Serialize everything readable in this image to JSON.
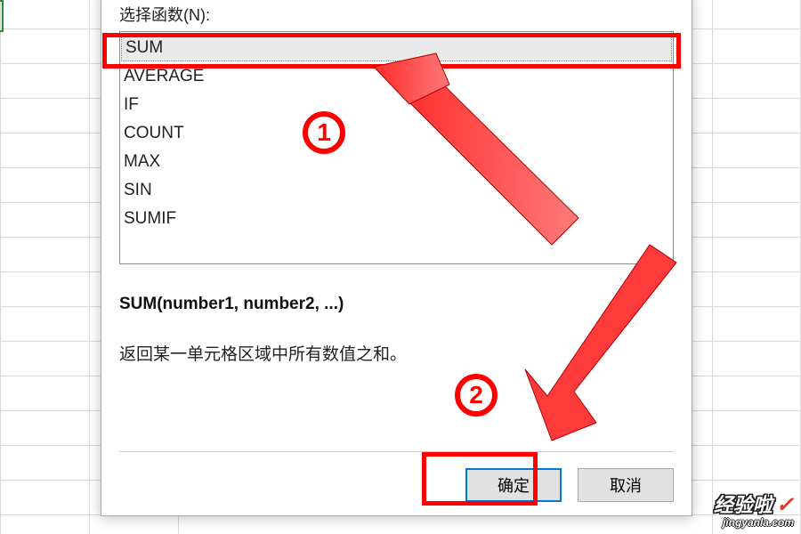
{
  "dialog": {
    "select_label": "选择函数(N):",
    "functions": [
      "SUM",
      "AVERAGE",
      "IF",
      "COUNT",
      "MAX",
      "SIN",
      "SUMIF"
    ],
    "syntax": "SUM(number1, number2, ...)",
    "description": "返回某一单元格区域中所有数值之和。",
    "ok_label": "确定",
    "cancel_label": "取消"
  },
  "callouts": {
    "badge1": "1",
    "badge2": "2"
  },
  "watermark": {
    "line1": "经验啦",
    "line2": "jingyanla.com"
  }
}
